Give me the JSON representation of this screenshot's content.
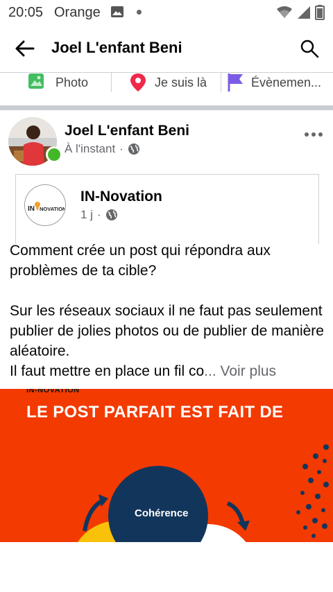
{
  "status_bar": {
    "time": "20:05",
    "carrier": "Orange"
  },
  "app_bar": {
    "title": "Joel L'enfant Beni"
  },
  "composer": {
    "photo": "Photo",
    "checkin": "Je suis là",
    "event": "Évènemen..."
  },
  "post": {
    "author": "Joel L'enfant Beni",
    "time": "À l'instant",
    "shared": {
      "name": "IN-Novation",
      "time": "1 j"
    },
    "text": "Comment crée un post qui répondra aux problèmes de ta cible?\n\nSur les réseaux sociaux il ne faut pas seulement publier de jolies photos ou de publier de manière aléatoire.\nIl faut mettre en place un fil co",
    "ellipsis": "...",
    "see_more": "Voir plus",
    "image": {
      "logo": "IN-NOVATION",
      "title": "LE POST PARFAIT EST FAIT DE",
      "circle_label": "Cohérence",
      "background": "#f33a00"
    }
  },
  "colors": {
    "online": "#42b72a",
    "checkin_pin": "#f02849",
    "event_flag": "#7c5ce6",
    "photo": "#45bd62"
  }
}
